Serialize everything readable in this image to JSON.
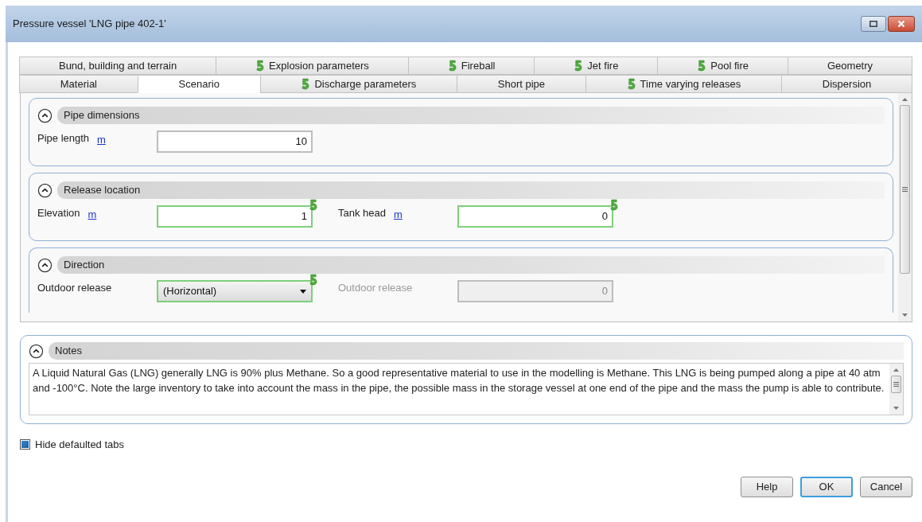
{
  "window": {
    "title": "Pressure vessel 'LNG pipe 402-1'"
  },
  "tab_rows": [
    [
      {
        "label": "Bund, building and terrain",
        "flagged": false,
        "selected": false
      },
      {
        "label": "Explosion parameters",
        "flagged": true,
        "selected": false
      },
      {
        "label": "Fireball",
        "flagged": true,
        "selected": false
      },
      {
        "label": "Jet fire",
        "flagged": true,
        "selected": false
      },
      {
        "label": "Pool fire",
        "flagged": true,
        "selected": false
      },
      {
        "label": "Geometry",
        "flagged": false,
        "selected": false
      }
    ],
    [
      {
        "label": "Material",
        "flagged": false,
        "selected": false
      },
      {
        "label": "Scenario",
        "flagged": false,
        "selected": true
      },
      {
        "label": "Discharge parameters",
        "flagged": true,
        "selected": false
      },
      {
        "label": "Short pipe",
        "flagged": false,
        "selected": false
      },
      {
        "label": "Time varying releases",
        "flagged": true,
        "selected": false
      },
      {
        "label": "Dispersion",
        "flagged": false,
        "selected": false
      }
    ]
  ],
  "sections": [
    {
      "title": "Pipe dimensions",
      "expanded": true,
      "fields": [
        {
          "kind": "text",
          "label": "Pipe length",
          "unit": "m",
          "value": "10",
          "flagged": false,
          "disabled": false
        }
      ]
    },
    {
      "title": "Release location",
      "expanded": true,
      "fields": [
        {
          "kind": "text",
          "label": "Elevation",
          "unit": "m",
          "value": "1",
          "flagged": true,
          "disabled": false
        },
        {
          "kind": "text",
          "label": "Tank head",
          "unit": "m",
          "value": "0",
          "flagged": true,
          "disabled": false
        }
      ]
    },
    {
      "title": "Direction",
      "expanded": true,
      "fields": [
        {
          "kind": "dropdown",
          "label": "Outdoor release",
          "value": "(Horizontal)",
          "flagged": true,
          "disabled": false
        },
        {
          "kind": "text",
          "label": "Outdoor release",
          "value": "0",
          "flagged": false,
          "disabled": true
        }
      ]
    }
  ],
  "notes": {
    "title": "Notes",
    "expanded": true,
    "text": "A Liquid Natural Gas (LNG) generally LNG is 90% plus Methane. So a good representative material to use in the modelling is Methane. This LNG is being pumped along a pipe at 40 atm and -100°C. Note the large inventory to take into account the mass in the pipe, the possible mass in the storage vessel at one end of the pipe and the mass the pump is able to contribute."
  },
  "hide_defaulted_tabs": {
    "label": "Hide defaulted tabs",
    "checked": true
  },
  "buttons": [
    {
      "label": "Help",
      "default": false
    },
    {
      "label": "OK",
      "default": true
    },
    {
      "label": "Cancel",
      "default": false
    }
  ]
}
